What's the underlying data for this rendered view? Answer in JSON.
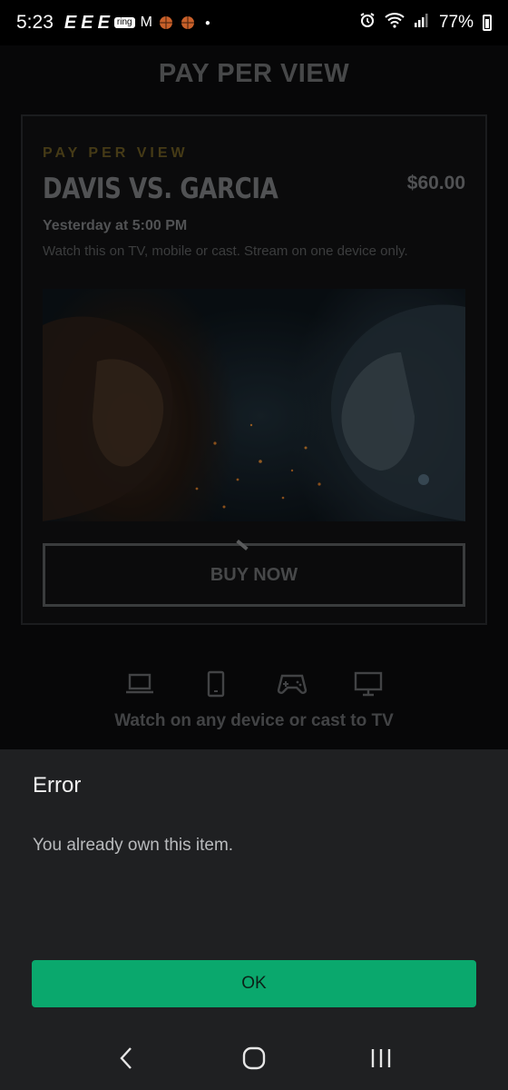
{
  "status_bar": {
    "time": "5:23",
    "notification_icons": [
      "espn-icon",
      "espn-icon",
      "espn-icon",
      "ring-icon",
      "gmail-icon",
      "nba-icon",
      "nba-icon"
    ],
    "espn_glyph": "E",
    "ring_label": "ring",
    "gmail_glyph": "M",
    "battery": "77%"
  },
  "page": {
    "title": "PAY PER VIEW"
  },
  "event": {
    "kicker": "PAY PER VIEW",
    "title": "DAVIS VS. GARCIA",
    "price": "$60.00",
    "time": "Yesterday at 5:00 PM",
    "description": "Watch this on TV, mobile or cast. Stream on one device only.",
    "buy_label": "BUY NOW"
  },
  "devices": {
    "icons": [
      "laptop-icon",
      "phone-icon",
      "gamepad-icon",
      "tv-icon"
    ],
    "caption": "Watch on any device or cast to TV"
  },
  "dialog": {
    "title": "Error",
    "message": "You already own this item.",
    "ok_label": "OK"
  },
  "colors": {
    "accent_green": "#0aa86d",
    "kicker_gold": "#6b5a22",
    "dialog_bg": "#1f2022"
  }
}
